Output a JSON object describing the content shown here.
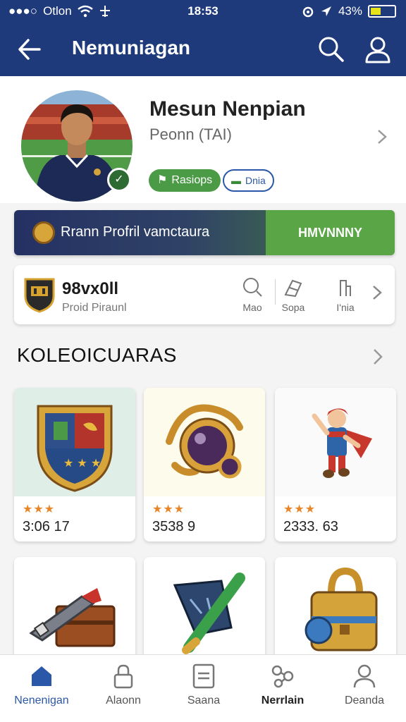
{
  "status_bar": {
    "carrier": "Otlon",
    "time": "18:53",
    "battery": "43%",
    "battery_level": 0.43
  },
  "app_bar": {
    "title": "Nemuniagan"
  },
  "profile": {
    "name": "Mesun Nenpian",
    "subtitle": "Peonn (TAI)",
    "pill_green": "Rasiops",
    "pill_outline": "Dnia"
  },
  "banner": {
    "text": "Rrann Profril vamctaura",
    "right_label": "HMVNNNY"
  },
  "stats": {
    "value": "98vx0ll",
    "label": "Proid Piraunl",
    "actions": [
      {
        "label": "Mao",
        "icon": "search-zoom-icon"
      },
      {
        "label": "Sopa",
        "icon": "share-icon"
      },
      {
        "label": "I'nia",
        "icon": "chart-icon"
      }
    ]
  },
  "section": {
    "title": "KOLEOICUARAS"
  },
  "cards": [
    {
      "stars": "★★★",
      "price": "3:06 17",
      "icon": "shield-crest-icon"
    },
    {
      "stars": "★★★",
      "price": "3538 9",
      "icon": "amulet-icon"
    },
    {
      "stars": "★★★",
      "price": "2333. 63",
      "icon": "hero-figure-icon"
    },
    {
      "stars": "",
      "price": "",
      "icon": "treasure-chest-icon"
    },
    {
      "stars": "",
      "price": "",
      "icon": "wand-scroll-icon"
    },
    {
      "stars": "",
      "price": "",
      "icon": "golden-bag-icon"
    }
  ],
  "bottom_nav": [
    {
      "label": "Nenenigan",
      "icon": "home-icon",
      "active": true
    },
    {
      "label": "Alaonn",
      "icon": "lock-icon",
      "active": false
    },
    {
      "label": "Saana",
      "icon": "document-icon",
      "active": false
    },
    {
      "label": "Nerrlain",
      "icon": "network-icon",
      "active": false
    },
    {
      "label": "Deanda",
      "icon": "profile-icon",
      "active": false
    }
  ],
  "colors": {
    "primary": "#1e3a7b",
    "accent_green": "#5aa545",
    "active_nav": "#2b57a8"
  }
}
